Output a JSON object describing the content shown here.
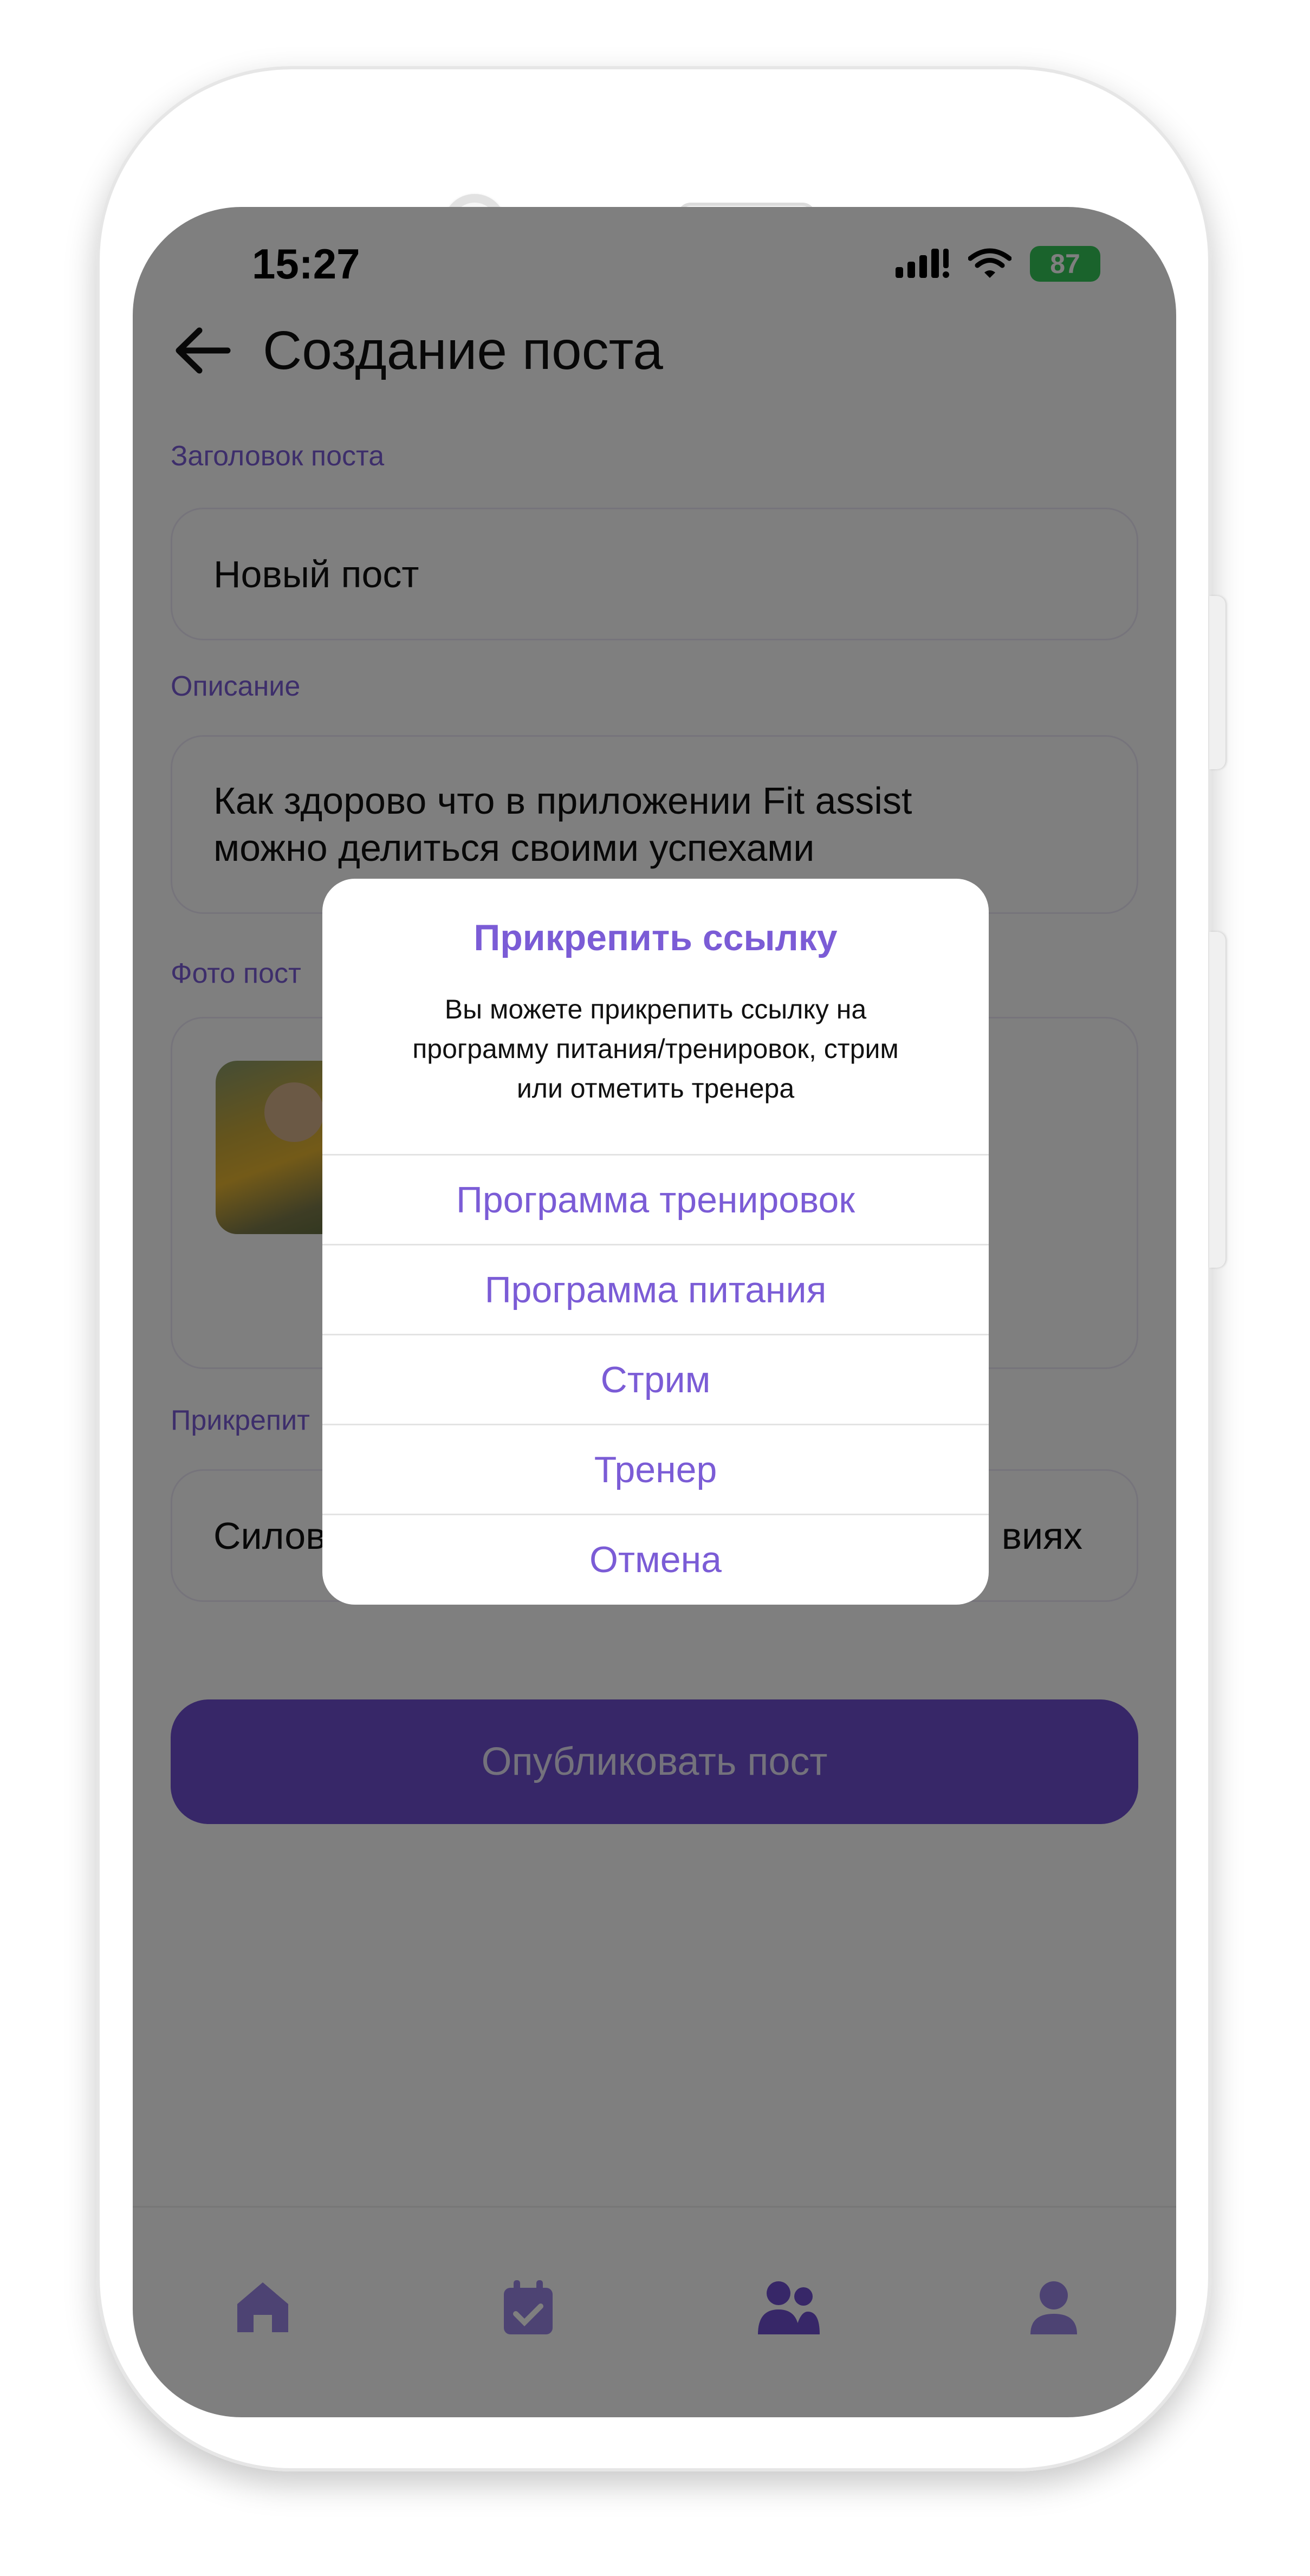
{
  "status_bar": {
    "time": "15:27",
    "battery": "87"
  },
  "header": {
    "title": "Создание поста"
  },
  "form": {
    "title_label": "Заголовок поста",
    "title_value": "Новый пост",
    "description_label": "Описание",
    "description_line1": "Как здорово что в приложении Fit assist",
    "description_line2": "можно делиться своими успехами",
    "photo_label": "Фото пост",
    "attach_label": "Прикрепит",
    "attach_value_left": "Силов",
    "attach_value_right": "виях"
  },
  "publish_button": "Опубликовать пост",
  "dialog": {
    "title": "Прикрепить ссылку",
    "text_line1": "Вы можете прикрепить ссылку на",
    "text_line2": "программу питания/тренировок, стрим",
    "text_line3": "или отметить тренера",
    "options": [
      "Программа тренировок",
      "Программа питания",
      "Стрим",
      "Тренер",
      "Отмена"
    ]
  },
  "tab_bar": {
    "icons": [
      "home-icon",
      "calendar-icon",
      "community-icon",
      "profile-icon"
    ]
  },
  "colors": {
    "accent": "#7b5cd6",
    "button": "#6e4fd0",
    "battery": "#34c759"
  }
}
